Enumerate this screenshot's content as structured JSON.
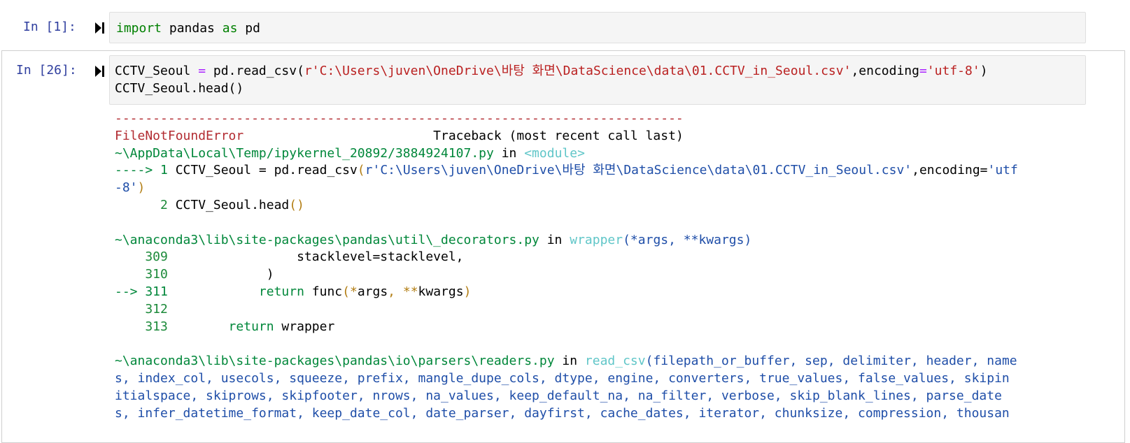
{
  "cell1": {
    "prompt": "In [1]:",
    "code": {
      "kw1": "import",
      "mid": " pandas ",
      "kw2": "as",
      "end": " pd"
    }
  },
  "cell2": {
    "prompt": "In [26]:",
    "line1": {
      "a": "CCTV_Seoul ",
      "eq": "=",
      "b": " pd.read_csv(",
      "str1": "r'C:\\Users\\juven\\OneDrive\\바탕 화면\\DataScience\\data\\01.CCTV_in_Seoul.csv'",
      "c": ",encoding",
      "eq2": "=",
      "str2": "'utf-8'",
      "d": ")"
    },
    "line2": "CCTV_Seoul.head()",
    "traceback": {
      "divider": "---------------------------------------------------------------------------",
      "error_name": "FileNotFoundError",
      "error_header": "                         Traceback (most recent call last)",
      "frame1_path": "~\\AppData\\Local\\Temp/ipykernel_20892/3884924107.py",
      "frame1_in": " in ",
      "frame1_module": "<module>",
      "frame1_arrow": "----> 1 ",
      "frame1_code_a": "CCTV_Seoul = pd.read_csv",
      "frame1_code_paren": "(",
      "frame1_code_str": "r'C:\\Users\\juven\\OneDrive\\바탕 화면\\DataScience\\data\\01.CCTV_in_Seoul.csv'",
      "frame1_code_b": ",encoding=",
      "frame1_code_str2a": "'utf",
      "frame1_code_str2b": "-8'",
      "frame1_code_close": ")",
      "frame1_line2_num": "      2 ",
      "frame1_line2_code": "CCTV_Seoul.head",
      "frame1_line2_parens": "()",
      "frame2_path": "~\\anaconda3\\lib\\site-packages\\pandas\\util\\_decorators.py",
      "frame2_in": " in ",
      "frame2_func": "wrapper",
      "frame2_args": "(*args, **kwargs)",
      "frame2_l309_num": "    309 ",
      "frame2_l309_code": "                stacklevel=stacklevel,",
      "frame2_l310_num": "    310 ",
      "frame2_l310_code": "            )",
      "frame2_l311_arrow": "--> 311 ",
      "frame2_l311_kw": "           return",
      "frame2_l311_code_a": " func",
      "frame2_l311_paren": "(",
      "frame2_l311_star1": "*",
      "frame2_l311_args": "args",
      "frame2_l311_comma": ", ",
      "frame2_l311_star2": "**",
      "frame2_l311_kwargs": "kwargs",
      "frame2_l311_close": ")",
      "frame2_l312_num": "    312 ",
      "frame2_l313_num": "    313 ",
      "frame2_l313_kw": "       return",
      "frame2_l313_code": " wrapper",
      "frame3_path": "~\\anaconda3\\lib\\site-packages\\pandas\\io\\parsers\\readers.py",
      "frame3_in": " in ",
      "frame3_func": "read_csv",
      "frame3_sig1": "(filepath_or_buffer, sep, delimiter, header, name",
      "frame3_sig2": "s, index_col, usecols, squeeze, prefix, mangle_dupe_cols, dtype, engine, converters, true_values, false_values, skipin",
      "frame3_sig3": "itialspace, skiprows, skipfooter, nrows, na_values, keep_default_na, na_filter, verbose, skip_blank_lines, parse_date",
      "frame3_sig4": "s, infer_datetime_format, keep_date_col, date_parser, dayfirst, cache_dates, iterator, chunksize, compression, thousan"
    }
  }
}
